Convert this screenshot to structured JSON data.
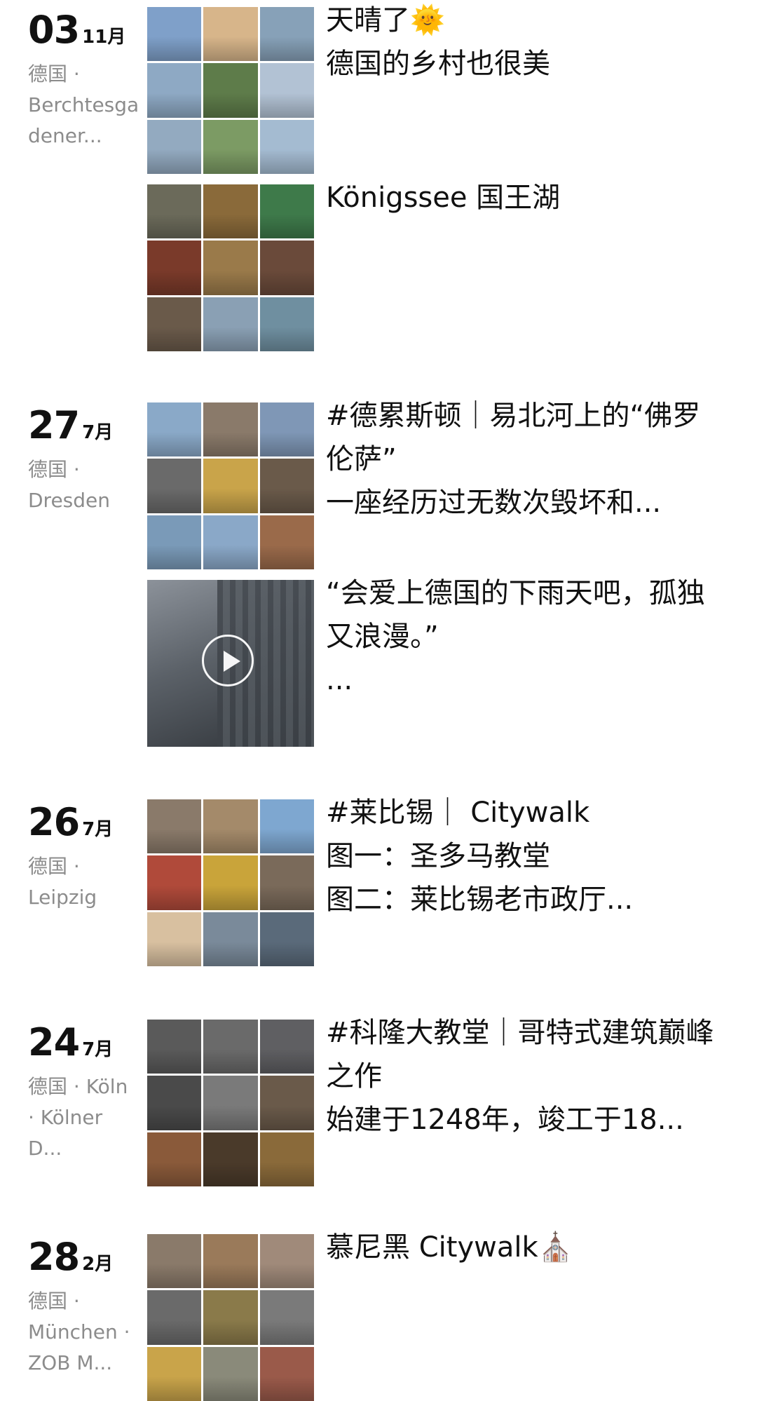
{
  "timeline": [
    {
      "day": "03",
      "month": "11月",
      "location": "德国 · Berchtesgadener...",
      "posts": [
        {
          "type": "photos",
          "text": "天晴了🌞\n德国的乡村也很美",
          "colors": [
            "#7fa0c9",
            "#d7b58a",
            "#87a1b8",
            "#8ea9c4",
            "#5e7c4a",
            "#b2c2d4",
            "#93aac0",
            "#7c9b64",
            "#a4bbd1"
          ]
        },
        {
          "type": "photos",
          "text": "Königssee 国王湖",
          "colors": [
            "#6b6a5a",
            "#8a6a3a",
            "#3e7a4a",
            "#7a3a2a",
            "#9a7a4a",
            "#6a4a3a",
            "#6a5a4a",
            "#8aa0b4",
            "#6f8fa0"
          ]
        }
      ]
    },
    {
      "day": "27",
      "month": "7月",
      "location": "德国 · Dresden",
      "posts": [
        {
          "type": "photos",
          "text": "#德累斯顿｜易北河上的“佛罗伦萨”\n一座经历过无数次毁坏和...",
          "colors": [
            "#8aa9c8",
            "#8a7a6a",
            "#7f97b6",
            "#6a6a6a",
            "#c9a44a",
            "#6a5a4a",
            "#7a9ab8",
            "#8aa8c8",
            "#9a6a4a"
          ]
        },
        {
          "type": "video",
          "text": "“会爱上德国的下雨天吧，孤独又浪漫。”\n..."
        }
      ]
    },
    {
      "day": "26",
      "month": "7月",
      "location": "德国 · Leipzig",
      "posts": [
        {
          "type": "photos",
          "text": "#莱比锡｜ Citywalk\n图一：圣多马教堂\n图二：莱比锡老市政厅...",
          "colors": [
            "#8a7a6a",
            "#a48a6a",
            "#7ea7d0",
            "#b04a3a",
            "#c9a43a",
            "#7a6a5a",
            "#d8c0a0",
            "#7a8a9a",
            "#5a6a7a"
          ]
        }
      ]
    },
    {
      "day": "24",
      "month": "7月",
      "location": "德国 · Köln · Kölner D...",
      "posts": [
        {
          "type": "photos",
          "text": "#科隆大教堂｜哥特式建筑巅峰之作\n始建于1248年，竣工于18...",
          "colors": [
            "#5a5a5a",
            "#6a6a6a",
            "#5f5f62",
            "#4a4a4a",
            "#7a7a7a",
            "#6a5a4a",
            "#8a5a3a",
            "#4a3a2a",
            "#8a6a3a"
          ]
        }
      ]
    },
    {
      "day": "28",
      "month": "2月",
      "location": "德国 · München · ZOB M...",
      "posts": [
        {
          "type": "photos",
          "text": "慕尼黑 Citywalk⛪",
          "colors": [
            "#8a7a6a",
            "#9a7a5a",
            "#a08a7a",
            "#6a6a6a",
            "#8a7a4a",
            "#7a7a7a",
            "#c9a44a",
            "#8a8a7a",
            "#9a5a4a"
          ]
        }
      ]
    }
  ]
}
